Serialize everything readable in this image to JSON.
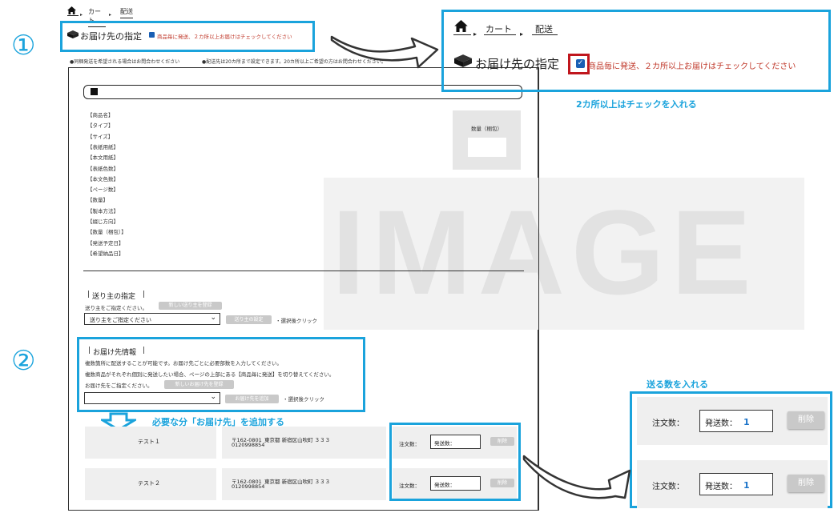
{
  "breadcrumb": {
    "home": "home-icon",
    "cart": "カート",
    "ship": "配送"
  },
  "step1": {
    "num": "①",
    "title": "お届け先の指定",
    "checkbox_label": "商品毎に発送、２カ所以上お届けはチェックしてください",
    "checked": true
  },
  "notes": {
    "left": "●同梱発送を希望される場合はお問合わせください",
    "right": "●配送先は20カ所まで設定できます。20カ所以上ご希望の方はお問合わせください。"
  },
  "product": {
    "fields": [
      "【商品名】",
      "【タイプ】",
      "【サイズ】",
      "【表紙用紙】",
      "【本文用紙】",
      "【表紙色数】",
      "【本文色数】",
      "【ページ数】",
      "【数量】",
      "【製本方法】",
      "【綴じ方向】",
      "【数量（梱包）】",
      "【発送予定日】",
      "【希望納品日】"
    ],
    "qty_label": "数量（梱包）",
    "watermark": "IMAGE"
  },
  "sender": {
    "title": "送り主の指定",
    "prompt": "送り主をご指定ください。",
    "register_btn": "新しい送り主を登録",
    "select_placeholder": "送り主をご指定ください",
    "set_btn": "送り主の設定",
    "hint": "・選択後クリック"
  },
  "step2": {
    "num": "②",
    "title": "お届け先情報",
    "desc1": "複数箇所に配送することが可能です。お届け先ごとに必要部数を入力してください。",
    "desc2": "複数商品がそれぞれ個別に発送したい場合、ページの上部にある【商品毎に発送】を切り替えてください。",
    "prompt": "お届け先をご指定ください。",
    "register_btn": "新しいお届け先を登録",
    "add_btn": "お届け先を追加",
    "hint": "・選択後クリック"
  },
  "annotations": {
    "check": "2カ所以上はチェックを入れる",
    "add": "必要な分「お届け先」を追加する",
    "qty": "送る数を入れる"
  },
  "recipients": [
    {
      "name": "テスト１",
      "postal": "〒162-0801",
      "address": "東京都 新宿区山吹町 ３３３",
      "phone": "0120998854",
      "order_label": "注文数：",
      "ship_label": "発送数：",
      "delete": "削除"
    },
    {
      "name": "テスト２",
      "postal": "〒162-0801",
      "address": "東京都 新宿区山吹町 ３３３",
      "phone": "0120998854",
      "order_label": "注文数：",
      "ship_label": "発送数：",
      "delete": "削除"
    }
  ],
  "zoom_rows": [
    {
      "order_label": "注文数：",
      "ship_label": "発送数：",
      "ship_value": "1",
      "delete": "削除"
    },
    {
      "order_label": "注文数：",
      "ship_label": "発送数：",
      "ship_value": "1",
      "delete": "削除"
    }
  ],
  "colors": {
    "accent": "#1aa3dc",
    "alert": "#c0392b",
    "button_gray": "#c9c9c9",
    "panel_gray": "#efefef"
  }
}
